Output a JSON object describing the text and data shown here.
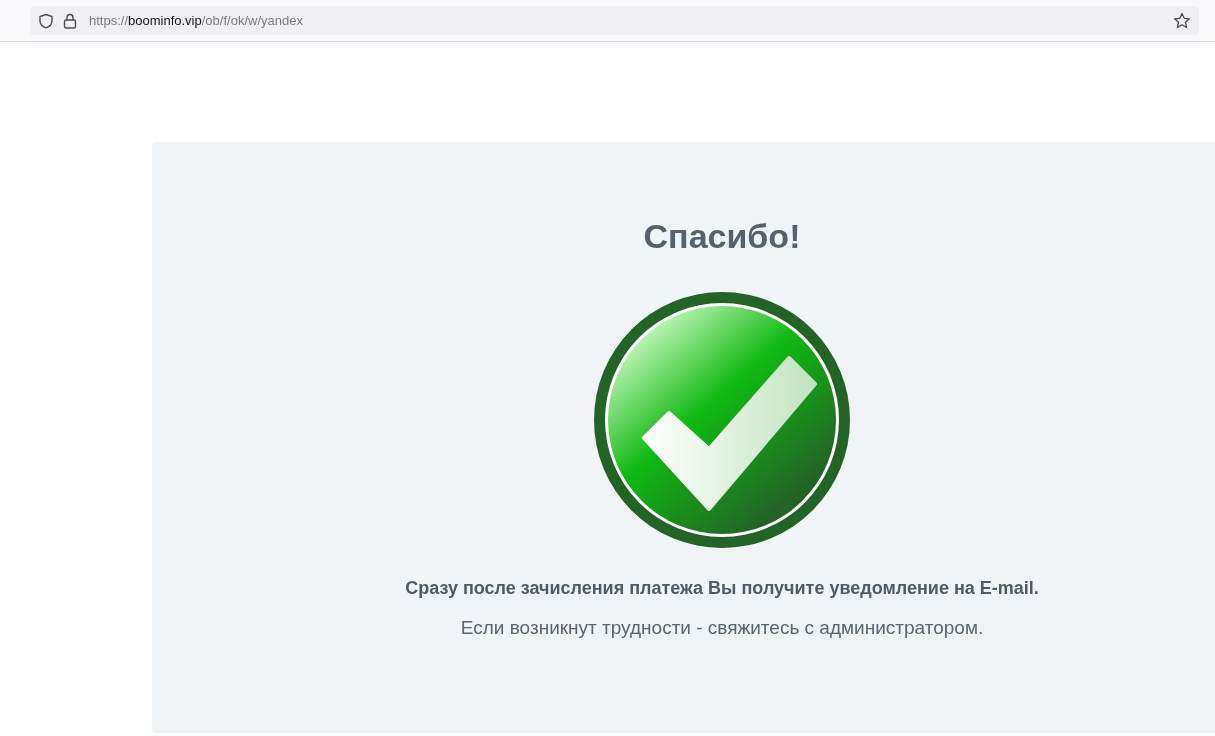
{
  "browser": {
    "url": {
      "scheme": "https://",
      "host": "boominfo.vip",
      "path": "/ob/f/ok/w/yandex"
    }
  },
  "page": {
    "title": "Спасибо!",
    "message": "Сразу после зачисления платежа Вы получите уведомление на E-mail.",
    "note": "Если возникнут трудности - свяжитесь с администратором."
  }
}
